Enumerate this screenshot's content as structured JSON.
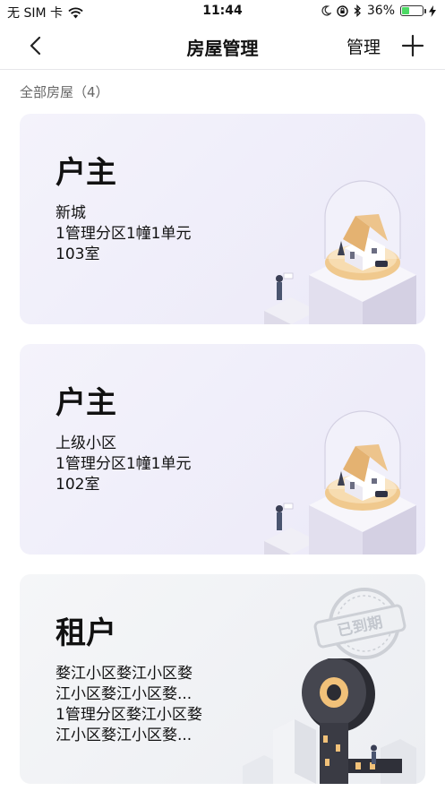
{
  "status_bar": {
    "carrier": "无 SIM 卡",
    "time": "11:44",
    "battery_percent": "36%",
    "battery_level": 0.36,
    "icons": [
      "wifi-icon",
      "moon-icon",
      "lock-rotation-icon",
      "bluetooth-icon",
      "battery-icon",
      "charging-icon"
    ]
  },
  "nav": {
    "back_icon": "chevron-left-icon",
    "title": "房屋管理",
    "manage_label": "管理",
    "add_icon": "plus-icon"
  },
  "list": {
    "header": "全部房屋（4）"
  },
  "houses": [
    {
      "role": "户主",
      "community": "新城",
      "unit": "1管理分区1幢1单元",
      "room": "103室"
    },
    {
      "role": "户主",
      "community": "上级小区",
      "unit": "1管理分区1幢1单元",
      "room": "102室"
    },
    {
      "role": "租户",
      "community_line1": "婺江小区婺江小区婺",
      "community_line2": "江小区婺江小区婺...",
      "unit_line1": "1管理分区婺江小区婺",
      "unit_line2": "江小区婺江小区婺...",
      "stamp": "已到期"
    }
  ],
  "colors": {
    "owner_card_bg": "#eceaf8",
    "tenant_card_bg": "#eff0f3",
    "house_roof": "#e8b97c",
    "stamp_gray": "#c9ccd2"
  }
}
